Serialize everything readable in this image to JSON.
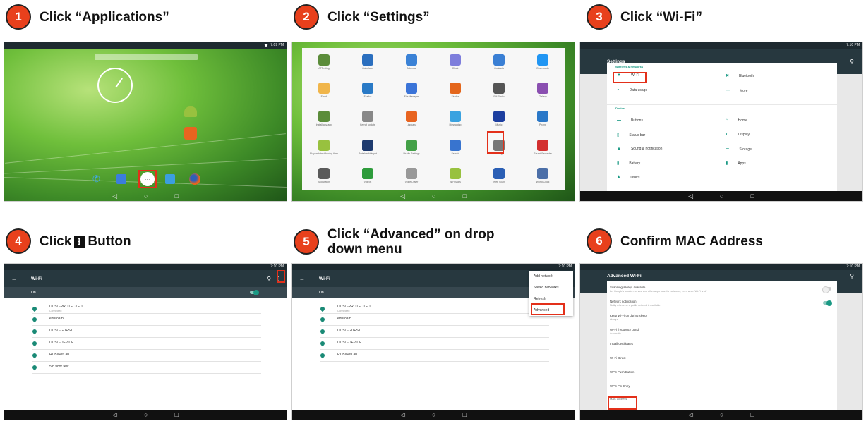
{
  "steps": [
    {
      "number": "1",
      "caption": "Click “Applications”"
    },
    {
      "number": "2",
      "caption": "Click “Settings”"
    },
    {
      "number": "3",
      "caption": "Click “Wi-Fi”"
    },
    {
      "number": "4",
      "caption_pre": "Click",
      "caption_post": "Button"
    },
    {
      "number": "5",
      "caption_line1": "Click “Advanced” on drop",
      "caption_line2": "down menu"
    },
    {
      "number": "6",
      "caption": "Confirm MAC Address"
    }
  ],
  "status": {
    "time1": "7:09 PM",
    "time2": "7:10 PM"
  },
  "apps": [
    "ATTesting",
    "Calculator",
    "Calendar",
    "Clock",
    "Contacts",
    "Downloads",
    "Email",
    "Firefox",
    "File Manager",
    "Firefox",
    "FM Radio",
    "Gallery",
    "Install any app",
    "Kernel update",
    "Lingkana",
    "Messaging",
    "Music",
    "Phone",
    "Playback/test forcing then",
    "Portable Hotspot",
    "Studio Settings",
    "Search",
    "Settings",
    "Sound Recorder",
    "Stopwatch",
    "Videos",
    "Voice Dialer",
    "WiFi/Mars",
    "Web Scan",
    "World Clock"
  ],
  "settings": {
    "title": "Settings",
    "section_wireless": "Wireless & networks",
    "wifi": "Wi-Fi",
    "bluetooth": "Bluetooth",
    "data_usage": "Data usage",
    "more": "More",
    "section_device": "Device",
    "buttons": "Buttons",
    "home": "Home",
    "status_bar": "Status bar",
    "display": "Display",
    "sound": "Sound & notification",
    "storage": "Storage",
    "battery": "Battery",
    "apps": "Apps",
    "users": "Users"
  },
  "wifi": {
    "title": "Wi-Fi",
    "on": "On",
    "networks": [
      {
        "name": "UCSD-PROTECTED",
        "sub": "Connected"
      },
      {
        "name": "eduroam",
        "sub": ""
      },
      {
        "name": "UCSD-GUEST",
        "sub": ""
      },
      {
        "name": "UCSD-DEVICE",
        "sub": ""
      },
      {
        "name": "RUBINetLab",
        "sub": ""
      },
      {
        "name": "5th floor test",
        "sub": ""
      }
    ]
  },
  "menu": [
    "Add network",
    "Saved networks",
    "Refresh",
    "Advanced"
  ],
  "advanced": {
    "title": "Advanced Wi-Fi",
    "items": [
      {
        "t": "Scanning always available",
        "s": "Let Google's location service and other apps scan for networks, even when Wi-Fi is off"
      },
      {
        "t": "Network notification",
        "s": "Notify whenever a public network is available"
      },
      {
        "t": "Keep Wi-Fi on during sleep",
        "s": "Always"
      },
      {
        "t": "Wi-Fi frequency band",
        "s": "Automatic"
      },
      {
        "t": "Install certificates",
        "s": ""
      },
      {
        "t": "Wi-Fi Direct",
        "s": ""
      },
      {
        "t": "WPS Push Button",
        "s": ""
      },
      {
        "t": "WPS Pin Entry",
        "s": ""
      }
    ],
    "mac_label": "MAC address",
    "mac_value": "00:0a:f5:2b:6c:60"
  },
  "colors": {
    "badge": "#e8401c",
    "highlight": "#e3301a",
    "appbar": "#27383f",
    "accent": "#1a9984"
  },
  "nav_icons": [
    "back-triangle",
    "home-circle",
    "recents-square"
  ]
}
